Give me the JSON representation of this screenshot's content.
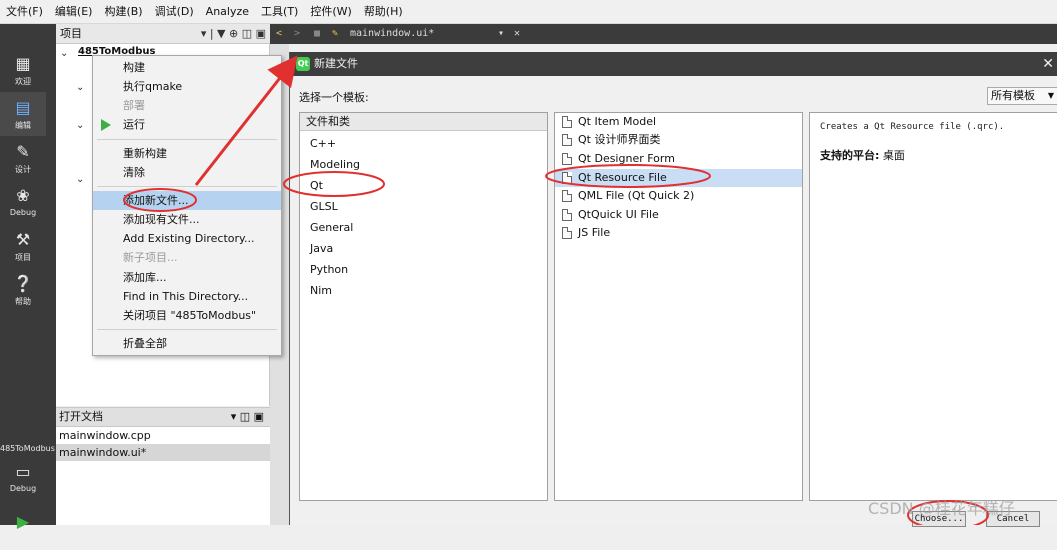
{
  "menubar": [
    "文件(F)",
    "编辑(E)",
    "构建(B)",
    "调试(D)",
    "Analyze",
    "工具(T)",
    "控件(W)",
    "帮助(H)"
  ],
  "modes": [
    {
      "label": "欢迎",
      "icon": "grid-icon"
    },
    {
      "label": "编辑",
      "icon": "edit-icon"
    },
    {
      "label": "设计",
      "icon": "pencil-icon"
    },
    {
      "label": "Debug",
      "icon": "bug-icon"
    },
    {
      "label": "项目",
      "icon": "wrench-icon"
    },
    {
      "label": "帮助",
      "icon": "help-icon"
    }
  ],
  "kit": {
    "project": "485ToModbus",
    "mode": "Debug"
  },
  "project_panel": {
    "title": "项目",
    "node": "485ToModbus"
  },
  "editor": {
    "file": "mainwindow.ui*"
  },
  "context_menu": [
    {
      "label": "构建",
      "disabled": false
    },
    {
      "label": "执行qmake",
      "disabled": false
    },
    {
      "label": "部署",
      "disabled": true
    },
    {
      "label": "运行",
      "disabled": false
    },
    {
      "label": "重新构建",
      "disabled": false
    },
    {
      "label": "清除",
      "disabled": false
    },
    {
      "label": "添加新文件...",
      "disabled": false
    },
    {
      "label": "添加现有文件...",
      "disabled": false
    },
    {
      "label": "Add Existing Directory...",
      "disabled": false
    },
    {
      "label": "新子项目...",
      "disabled": true
    },
    {
      "label": "添加库...",
      "disabled": false
    },
    {
      "label": "Find in This Directory...",
      "disabled": false
    },
    {
      "label": "关闭项目 \"485ToModbus\"",
      "disabled": false
    },
    {
      "label": "折叠全部",
      "disabled": false
    }
  ],
  "open_docs": {
    "title": "打开文档",
    "files": [
      "mainwindow.cpp",
      "mainwindow.ui*"
    ]
  },
  "dialog": {
    "title": "新建文件",
    "choose_template": "选择一个模板:",
    "filter": "所有模板",
    "categories_header": "文件和类",
    "categories": [
      "C++",
      "Modeling",
      "Qt",
      "GLSL",
      "General",
      "Java",
      "Python",
      "Nim"
    ],
    "templates": [
      "Qt Item Model",
      "Qt 设计师界面类",
      "Qt Designer Form",
      "Qt Resource File",
      "QML File (Qt Quick 2)",
      "QtQuick UI File",
      "JS File"
    ],
    "description": "Creates a Qt Resource file (.qrc).",
    "platform_label": "支持的平台:",
    "platform_value": "桌面",
    "choose_btn": "Choose...",
    "cancel_btn": "Cancel"
  },
  "watermark": "CSDN @桂花年糕仔",
  "colors": {
    "annotation": "#e03030",
    "selection": "#c9def5"
  }
}
